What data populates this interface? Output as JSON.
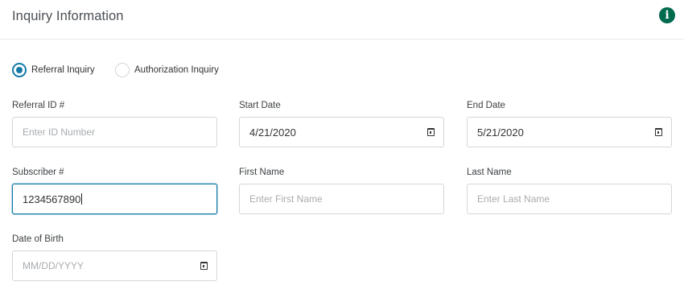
{
  "header": {
    "title": "Inquiry Information",
    "info_icon": "info-icon"
  },
  "inquiry_type": {
    "options": [
      {
        "label": "Referral Inquiry",
        "checked": true
      },
      {
        "label": "Authorization Inquiry",
        "checked": false
      }
    ]
  },
  "fields": {
    "referral_id": {
      "label": "Referral ID #",
      "value": "",
      "placeholder": "Enter ID Number"
    },
    "start_date": {
      "label": "Start Date",
      "value": "4/21/2020"
    },
    "end_date": {
      "label": "End Date",
      "value": "5/21/2020"
    },
    "subscriber": {
      "label": "Subscriber #",
      "value": "1234567890"
    },
    "first_name": {
      "label": "First Name",
      "value": "",
      "placeholder": "Enter First Name"
    },
    "last_name": {
      "label": "Last Name",
      "value": "",
      "placeholder": "Enter Last Name"
    },
    "dob": {
      "label": "Date of Birth",
      "value": "",
      "placeholder": "MM/DD/YYYY"
    }
  },
  "colors": {
    "accent": "#137aa8",
    "info_icon": "#006b4e",
    "border": "#d3d6d9",
    "placeholder": "#a8acb0"
  }
}
